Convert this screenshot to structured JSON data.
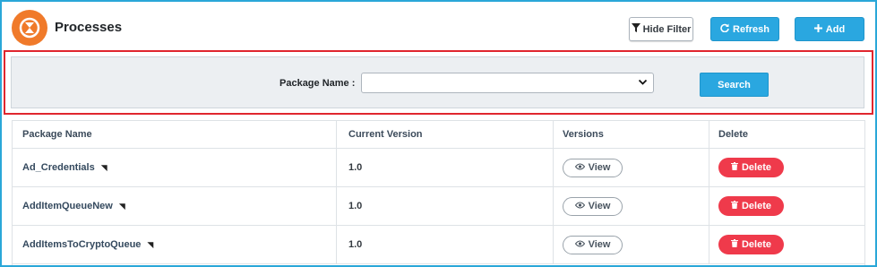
{
  "header": {
    "title": "Processes",
    "hide_filter_label": "Hide Filter",
    "refresh_label": "Refresh",
    "add_label": "Add"
  },
  "filter": {
    "package_name_label": "Package Name :",
    "package_name_value": "",
    "search_label": "Search"
  },
  "table": {
    "columns": [
      "Package Name",
      "Current Version",
      "Versions",
      "Delete"
    ],
    "rows": [
      {
        "package_name": "Ad_Credentials",
        "current_version": "1.0",
        "view_label": "View",
        "delete_label": "Delete"
      },
      {
        "package_name": "AddItemQueueNew",
        "current_version": "1.0",
        "view_label": "View",
        "delete_label": "Delete"
      },
      {
        "package_name": "AddItemsToCryptoQueue",
        "current_version": "1.0",
        "view_label": "View",
        "delete_label": "Delete"
      }
    ]
  },
  "colors": {
    "accent": "#2aa7e0",
    "logo": "#f07a2a",
    "danger": "#ef3a4b",
    "highlight_border": "#e0262e"
  },
  "icons": [
    "process-logo-icon",
    "filter-icon",
    "refresh-icon",
    "plus-icon",
    "chevron-down-icon",
    "cursor-icon",
    "eye-icon",
    "trash-icon"
  ]
}
